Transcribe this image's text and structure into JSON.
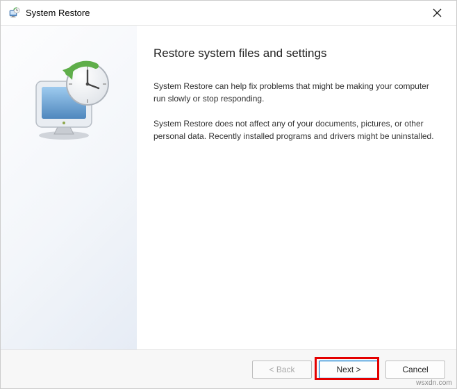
{
  "window": {
    "title": "System Restore"
  },
  "content": {
    "heading": "Restore system files and settings",
    "paragraph1": "System Restore can help fix problems that might be making your computer run slowly or stop responding.",
    "paragraph2": "System Restore does not affect any of your documents, pictures, or other personal data. Recently installed programs and drivers might be uninstalled."
  },
  "buttons": {
    "back": "< Back",
    "next": "Next >",
    "cancel": "Cancel"
  },
  "watermark": "wsxdn.com"
}
